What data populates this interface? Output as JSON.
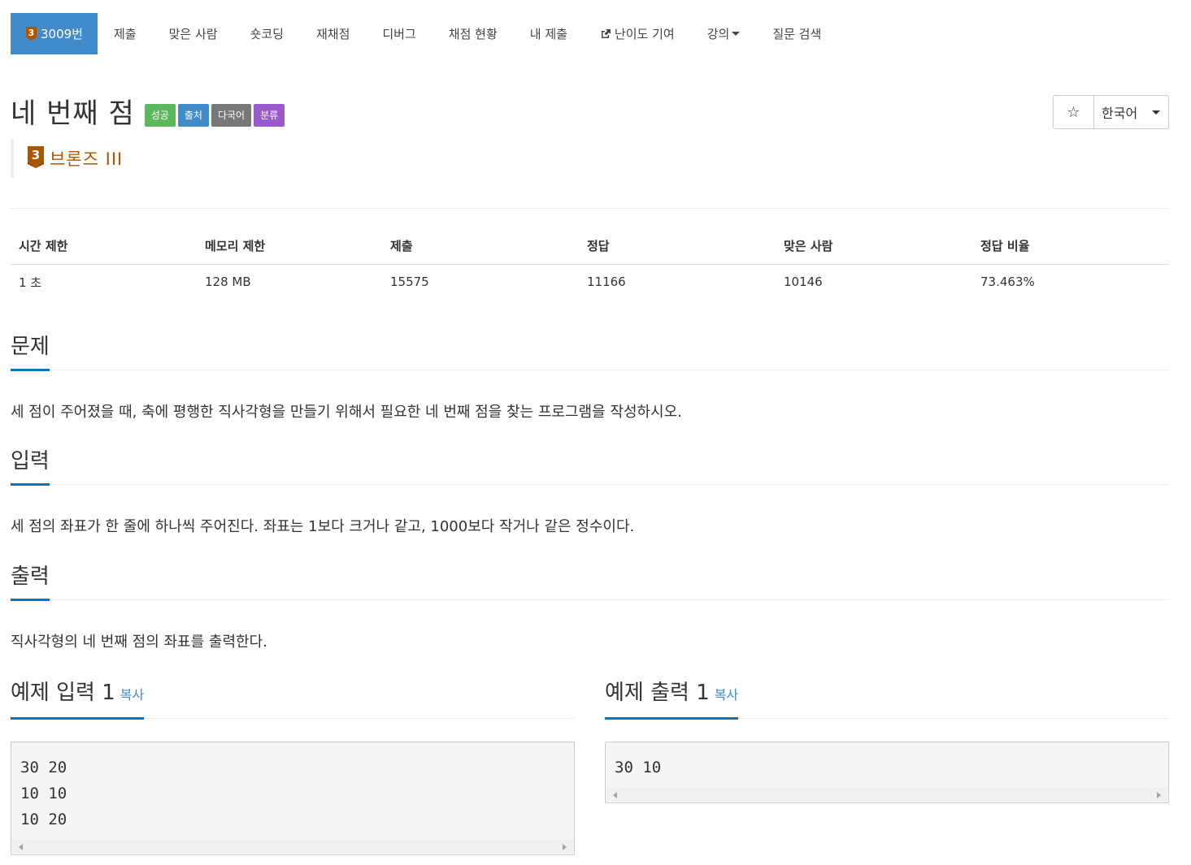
{
  "nav": {
    "problem_label": "3009번",
    "tier_number": "3",
    "items": [
      "제출",
      "맞은 사람",
      "숏코딩",
      "재채점",
      "디버그",
      "채점 현황",
      "내 제출",
      "난이도 기여",
      "강의",
      "질문 검색"
    ]
  },
  "title": "네 번째 점",
  "labels": [
    {
      "text": "성공",
      "color": "#5cb85c"
    },
    {
      "text": "출처",
      "color": "#428bca"
    },
    {
      "text": "다국어",
      "color": "#777777"
    },
    {
      "text": "분류",
      "color": "#9b59d0"
    }
  ],
  "tier": {
    "number": "3",
    "text": "브론즈 III",
    "color": "#ad5600"
  },
  "controls": {
    "star": "☆",
    "language": "한국어"
  },
  "info": {
    "headers": [
      "시간 제한",
      "메모리 제한",
      "제출",
      "정답",
      "맞은 사람",
      "정답 비율"
    ],
    "values": [
      "1 초",
      "128 MB",
      "15575",
      "11166",
      "10146",
      "73.463%"
    ]
  },
  "sections": {
    "problem": {
      "title": "문제",
      "body": "세 점이 주어졌을 때, 축에 평행한 직사각형을 만들기 위해서 필요한 네 번째 점을 찾는 프로그램을 작성하시오."
    },
    "input": {
      "title": "입력",
      "body": "세 점의 좌표가 한 줄에 하나씩 주어진다. 좌표는 1보다 크거나 같고, 1000보다 작거나 같은 정수이다."
    },
    "output": {
      "title": "출력",
      "body": "직사각형의 네 번째 점의 좌표를 출력한다."
    }
  },
  "samples": {
    "input": {
      "title": "예제 입력 1",
      "copy": "복사",
      "lines": [
        "30 20",
        "10 10",
        "10 20"
      ]
    },
    "output": {
      "title": "예제 출력 1",
      "copy": "복사",
      "lines": [
        "30 10"
      ]
    }
  },
  "colors": {
    "accent": "#428bca",
    "underline": "#0076c0"
  }
}
